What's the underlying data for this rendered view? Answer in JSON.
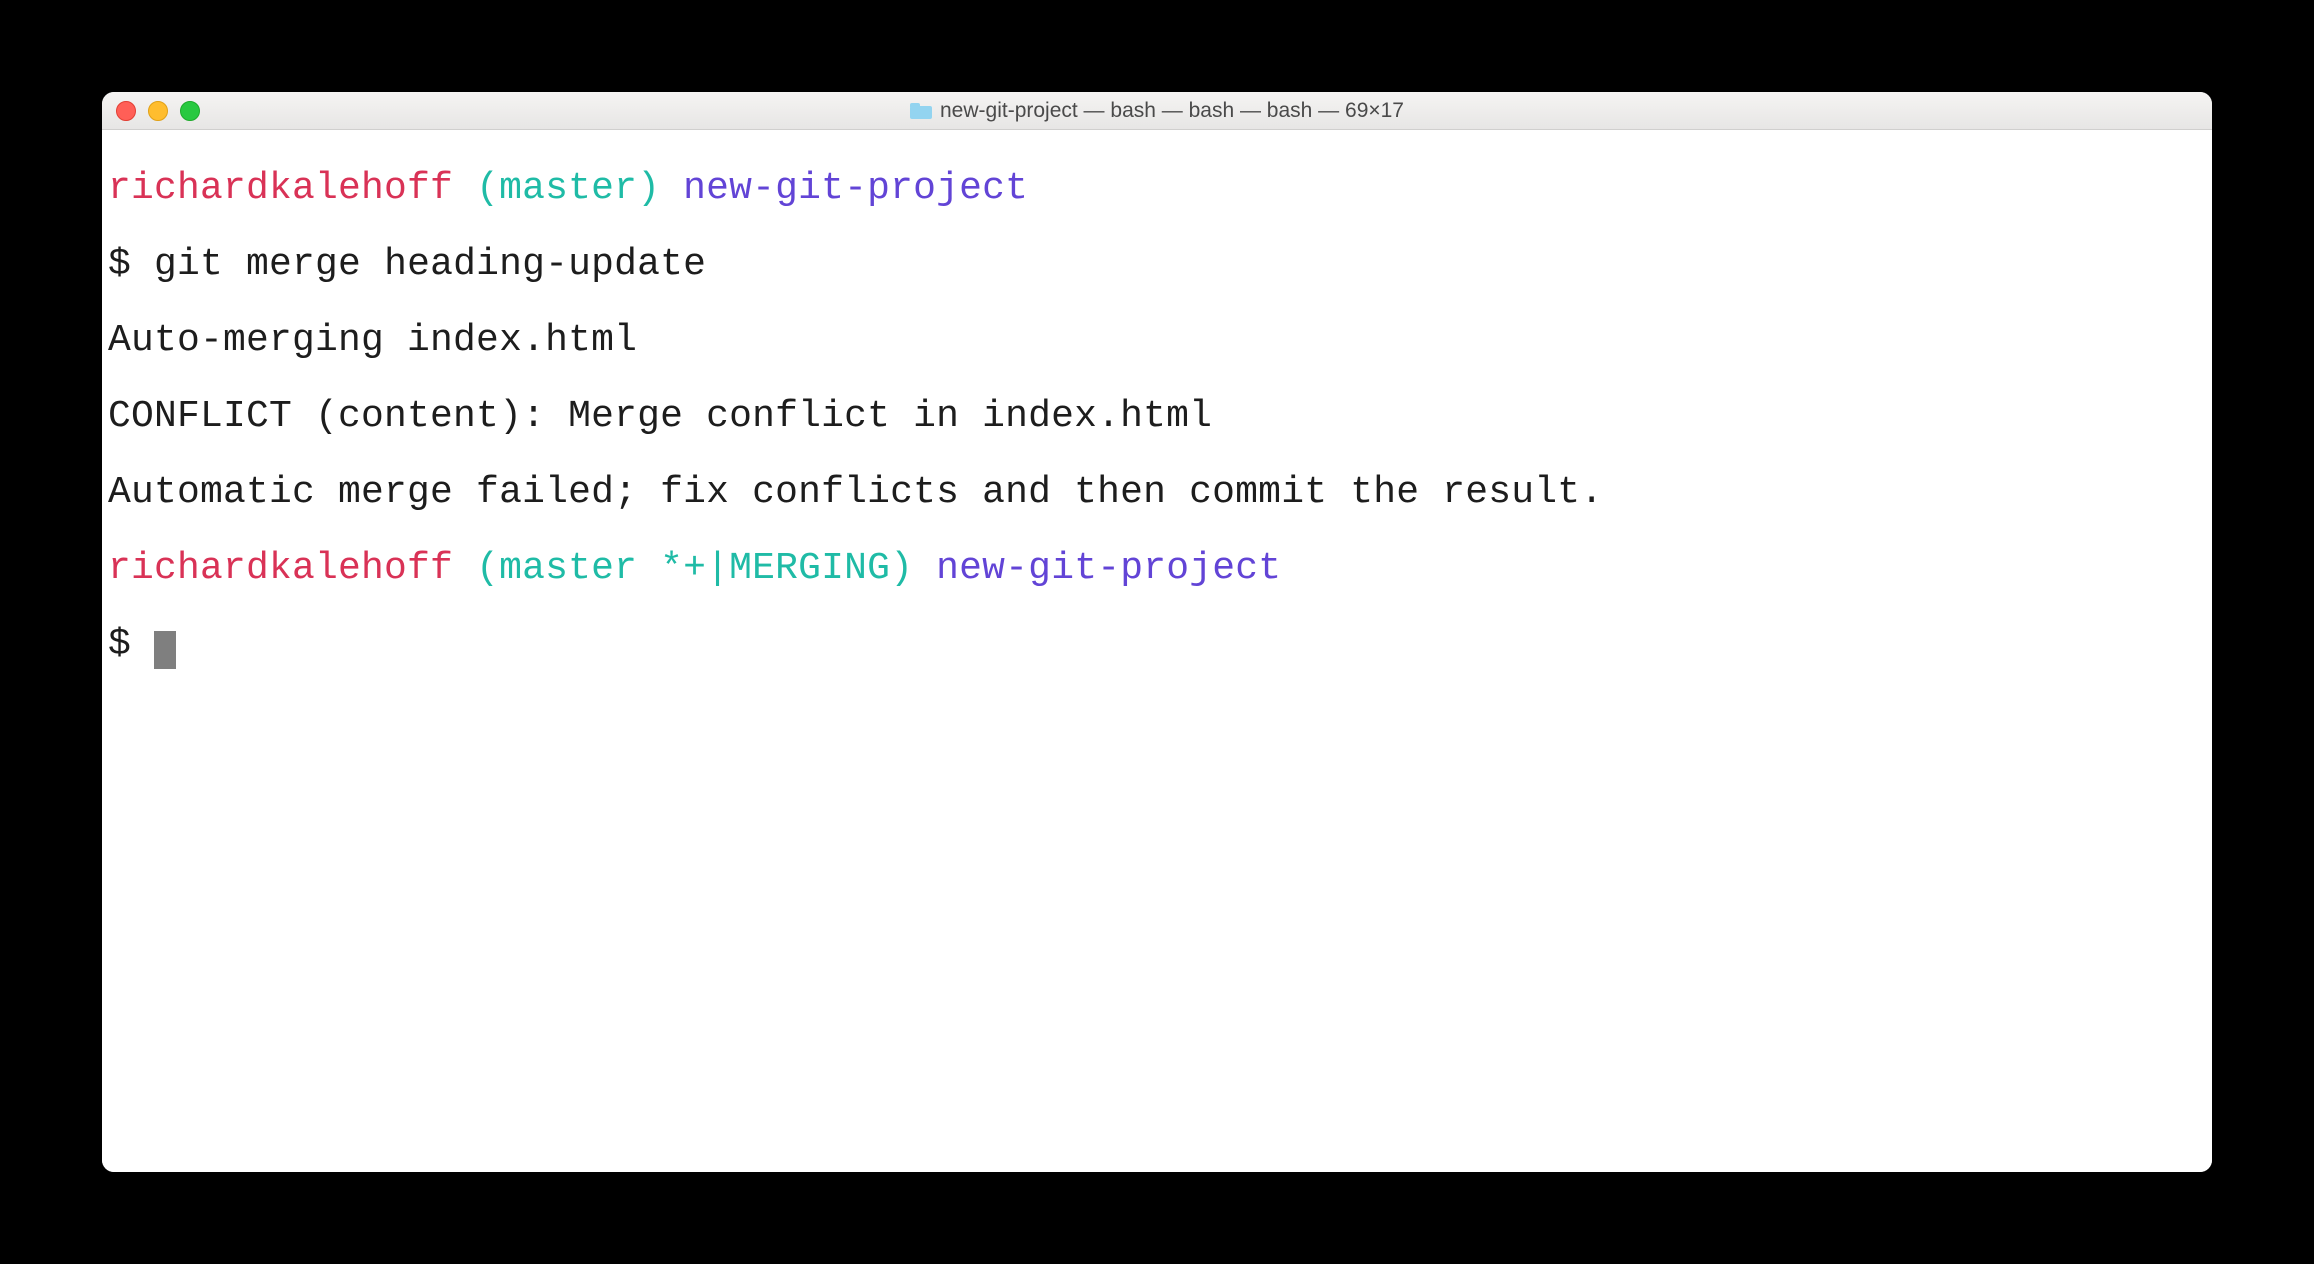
{
  "window": {
    "title": "new-git-project — bash — bash — bash — 69×17"
  },
  "prompt1": {
    "user": "richardkalehoff",
    "branch": "(master)",
    "dir": "new-git-project"
  },
  "command1": {
    "symbol": "$",
    "text": "git merge heading-update"
  },
  "output": {
    "line1": "Auto-merging index.html",
    "line2": "CONFLICT (content): Merge conflict in index.html",
    "line3": "Automatic merge failed; fix conflicts and then commit the result."
  },
  "prompt2": {
    "user": "richardkalehoff",
    "branch": "(master *+|MERGING)",
    "dir": "new-git-project"
  },
  "command2": {
    "symbol": "$"
  }
}
